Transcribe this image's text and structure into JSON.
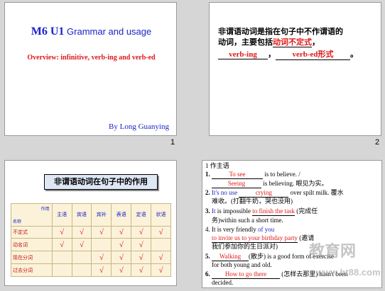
{
  "slide1": {
    "title_mu": "M6  U1",
    "title_rest": " Grammar and usage",
    "overview": "Overview: infinitive, verb-ing and verb-ed",
    "author": "By Long Guanying",
    "number": "1"
  },
  "slide2": {
    "line1": "非谓语动词是指在句子中不作谓语的",
    "line2_prefix": "动词，主要包括",
    "line2_red": "动词不定式",
    "line2_suffix": "，",
    "blank1": "verb-ing",
    "sep": "，",
    "blank2": "verb-ed形式",
    "end": "。",
    "number": "2"
  },
  "slide3": {
    "title": "非谓语动词在句子中的作用",
    "corner_top": "作用",
    "corner_bottom": "名称",
    "columns": [
      "主语",
      "宾语",
      "宾补",
      "表语",
      "定语",
      "状语"
    ],
    "rows": [
      {
        "name": "不定式",
        "marks": [
          "√",
          "√",
          "√",
          "√",
          "√",
          "√"
        ]
      },
      {
        "name": "动名词",
        "marks": [
          "√",
          "√",
          "",
          "√",
          "√",
          ""
        ]
      },
      {
        "name": "现在分词",
        "marks": [
          "",
          "",
          "√",
          "√",
          "√",
          "√"
        ]
      },
      {
        "name": "过去分词",
        "marks": [
          "",
          "",
          "√",
          "√",
          "√",
          "√"
        ]
      }
    ],
    "check_color": "#e01818"
  },
  "slide4": {
    "heading": "1 作主语",
    "l1_num": "1.",
    "l1_blank": "To see",
    "l1_rest": " is to believe. /",
    "l2_blank": "Seeing",
    "l2_rest": " is believing. 眼见为实。",
    "l3_num": "2.",
    "l3_blue": "It's no use",
    "l3_blank": "crying",
    "l3_rest": " over spilt milk. 覆水",
    "l4": "难收。(打翻牛奶，哭也没用)",
    "l5_num": "3.",
    "l5_blue": "It",
    "l5_mid": " is impossible ",
    "l5_blank": "to finish the task",
    "l5_rest": " (完成任",
    "l6": "务)within such a short time.",
    "l7_pre": "4. It is very friendly ",
    "l7_blue": "of you",
    "l8_blank": "to invite us to your birthday party",
    "l8_rest": " (邀请",
    "l9": "我们参加你的生日派对)",
    "l10_num": "5.",
    "l10_blank": "Walking",
    "l10_rest": "(散步) is a good form of exercise",
    "l11": "for both young and old.",
    "l12_num": "6.",
    "l12_blank": "How to go there",
    "l12_rest": " (怎样去那里) hasn't been",
    "l13": "decided.",
    "watermark1": "教育网",
    "watermark2": "www.ht88.com"
  }
}
